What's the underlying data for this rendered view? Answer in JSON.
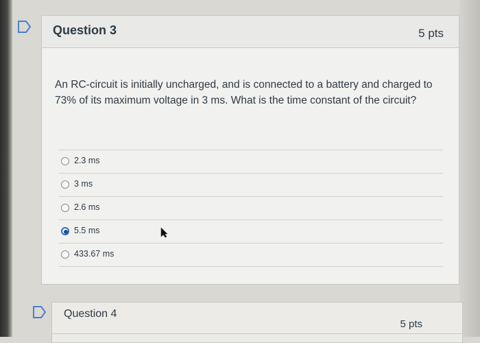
{
  "question3": {
    "title": "Question 3",
    "points": "5 pts",
    "text": "An RC-circuit is initially uncharged, and is connected to a battery and charged to 73% of its maximum voltage in 3 ms.  What is the time constant of the circuit?",
    "answers": [
      {
        "label": "2.3 ms",
        "selected": false
      },
      {
        "label": "3 ms",
        "selected": false
      },
      {
        "label": "2.6 ms",
        "selected": false
      },
      {
        "label": "5.5 ms",
        "selected": true
      },
      {
        "label": "433.67 ms",
        "selected": false
      }
    ]
  },
  "question4": {
    "title": "Question 4",
    "points": "5 pts"
  },
  "icons": {
    "flag": "bookmark-flag-icon",
    "cursor": "mouse-pointer-icon"
  },
  "colors": {
    "selected_radio": "#2c6fbe",
    "text": "#2d3b45",
    "flag_outline": "#3a6fc0"
  }
}
